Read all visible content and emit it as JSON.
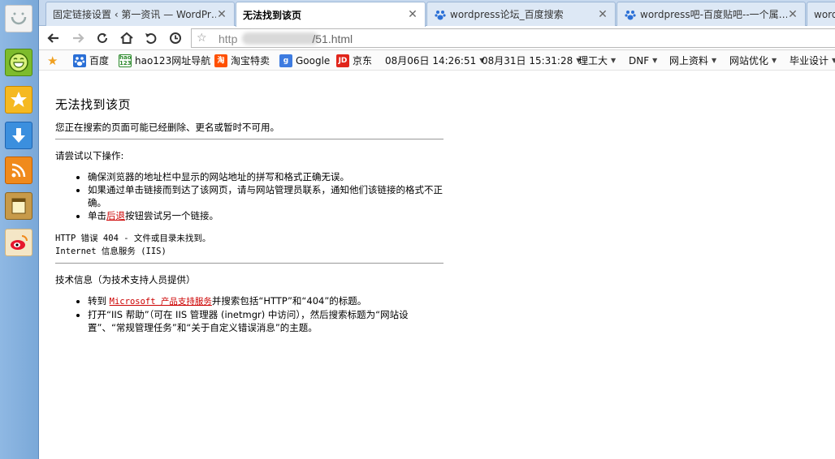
{
  "tabs": [
    {
      "label": "固定链接设置 ‹ 第一资讯 — WordPr…",
      "active": false
    },
    {
      "label": "无法找到该页",
      "active": true
    },
    {
      "label": "wordpress论坛_百度搜索",
      "active": false
    },
    {
      "label": "wordpress吧-百度贴吧--一个属…",
      "active": false
    },
    {
      "label": "word",
      "active": false
    }
  ],
  "address": {
    "prefix": "http",
    "suffix": "/51.html"
  },
  "bookmarks": [
    {
      "label": "百度",
      "icon": "baidu-paw-icon",
      "dropdown": false
    },
    {
      "label": "hao123网址导航",
      "icon": "hao123-icon",
      "dropdown": false
    },
    {
      "label": "淘宝特卖",
      "icon": "taobao-icon",
      "dropdown": false
    },
    {
      "label": "Google",
      "icon": "google-icon",
      "dropdown": false
    },
    {
      "label": "京东",
      "icon": "jd-icon",
      "dropdown": false
    },
    {
      "label": "08月06日 14:26:51",
      "icon": "",
      "dropdown": true
    },
    {
      "label": "08月31日 15:31:28",
      "icon": "",
      "dropdown": true
    },
    {
      "label": "理工大",
      "icon": "",
      "dropdown": true
    },
    {
      "label": "DNF",
      "icon": "",
      "dropdown": true
    },
    {
      "label": "网上资料",
      "icon": "",
      "dropdown": true
    },
    {
      "label": "网站优化",
      "icon": "",
      "dropdown": true
    },
    {
      "label": "毕业设计",
      "icon": "",
      "dropdown": true
    }
  ],
  "page": {
    "title": "无法找到该页",
    "subtitle": "您正在搜索的页面可能已经删除、更名或暂时不可用。",
    "try_heading": "请尝试以下操作:",
    "try_items": [
      "确保浏览器的地址栏中显示的网站地址的拼写和格式正确无误。",
      "如果通过单击链接而到达了该网页，请与网站管理员联系，通知他们该链接的格式不正确。"
    ],
    "back_prefix": "单击",
    "back_link": "后退",
    "back_suffix": "按钮尝试另一个链接。",
    "error_line": "HTTP 错误 404 - 文件或目录未找到。",
    "iis_line": "Internet 信息服务 (IIS)",
    "tech_heading": "技术信息（为技术支持人员提供）",
    "tech_goto_prefix": "转到 ",
    "tech_goto_link": "Microsoft 产品支持服务",
    "tech_goto_suffix": "并搜索包括“HTTP”和“404”的标题。",
    "tech_iis_help": "打开“IIS 帮助”（可在 IIS 管理器 (inetmgr) 中访问），然后搜索标题为“网站设置”、“常规管理任务”和“关于自定义错误消息”的主题。"
  },
  "colors": {
    "sidebar": "#7aa8d8",
    "tabbar": "#c6d8ee",
    "link": "#cc0000"
  }
}
